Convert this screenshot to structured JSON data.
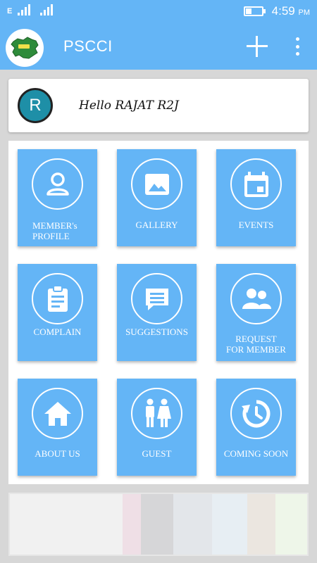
{
  "status_bar": {
    "network_type": "E",
    "time": "4:59",
    "ampm": "PM",
    "battery_level": 0.35
  },
  "app_bar": {
    "title": "PSCCI",
    "add_icon": "plus-icon",
    "menu_icon": "more-vert-icon"
  },
  "greeting": {
    "avatar_letter": "R",
    "text": "Hello RAJAT R2J"
  },
  "tiles": [
    {
      "label_line1": "MEMBER's",
      "label_line2": "PROFILE",
      "icon": "person-icon"
    },
    {
      "label_line1": "GALLERY",
      "label_line2": "",
      "icon": "image-icon"
    },
    {
      "label_line1": "EVENTS",
      "label_line2": "",
      "icon": "calendar-icon"
    },
    {
      "label_line1": "COMPLAIN",
      "label_line2": "",
      "icon": "clipboard-icon"
    },
    {
      "label_line1": "SUGGESTIONS",
      "label_line2": "",
      "icon": "chat-icon"
    },
    {
      "label_line1": "REQUEST",
      "label_line2": "FOR MEMBER",
      "icon": "group-icon"
    },
    {
      "label_line1": "ABOUT US",
      "label_line2": "",
      "icon": "home-icon"
    },
    {
      "label_line1": "GUEST",
      "label_line2": "",
      "icon": "people-icon"
    },
    {
      "label_line1": "COMING SOON",
      "label_line2": "",
      "icon": "history-icon"
    }
  ],
  "colors": {
    "primary": "#64b5f6",
    "avatar_bg": "#1e8fa7",
    "page_bg": "#d7d7d7"
  }
}
